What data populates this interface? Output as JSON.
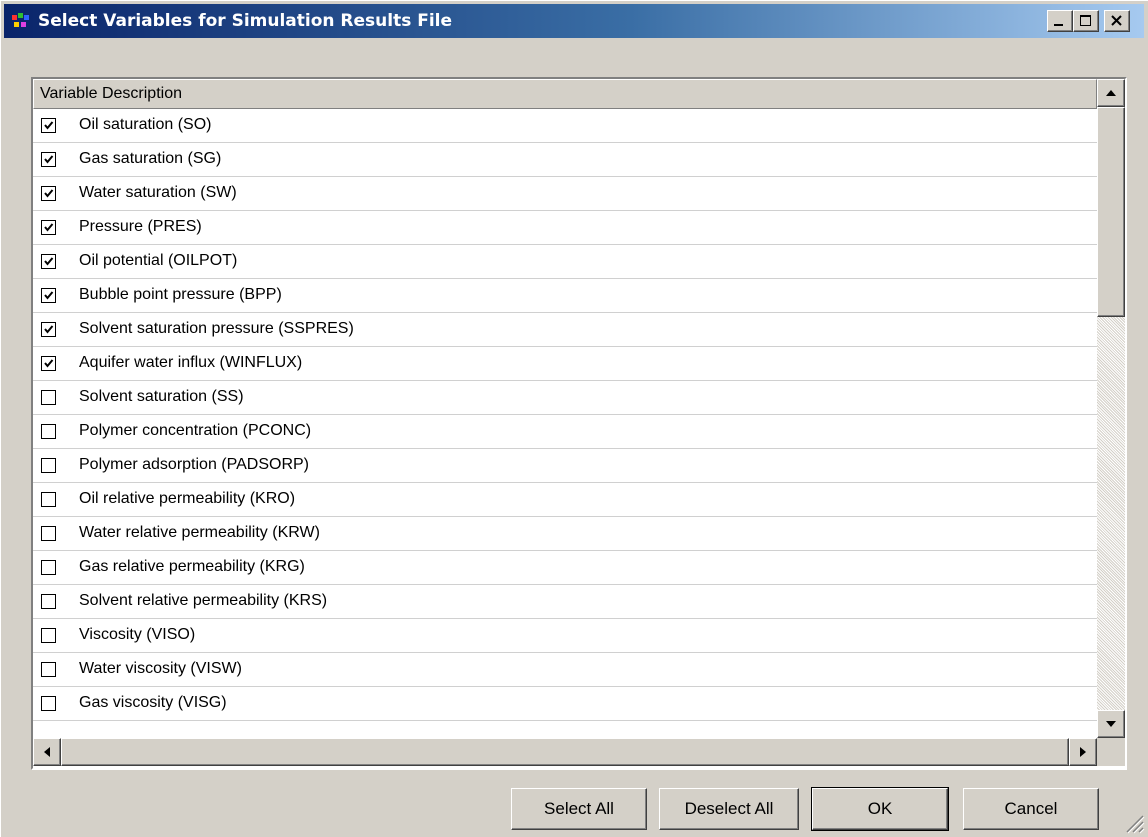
{
  "window": {
    "title": "Select Variables for Simulation Results File",
    "controls": {
      "minimize_icon": "minimize-icon",
      "maximize_icon": "maximize-icon",
      "close_icon": "close-icon"
    }
  },
  "list": {
    "column_header": "Variable Description",
    "rows": [
      {
        "label": "Oil saturation (SO)",
        "checked": true
      },
      {
        "label": "Gas saturation (SG)",
        "checked": true
      },
      {
        "label": "Water saturation (SW)",
        "checked": true
      },
      {
        "label": "Pressure (PRES)",
        "checked": true
      },
      {
        "label": "Oil potential (OILPOT)",
        "checked": true
      },
      {
        "label": "Bubble point pressure (BPP)",
        "checked": true
      },
      {
        "label": "Solvent saturation pressure (SSPRES)",
        "checked": true
      },
      {
        "label": "Aquifer water influx (WINFLUX)",
        "checked": true
      },
      {
        "label": "Solvent saturation (SS)",
        "checked": false
      },
      {
        "label": "Polymer concentration (PCONC)",
        "checked": false
      },
      {
        "label": "Polymer adsorption (PADSORP)",
        "checked": false
      },
      {
        "label": "Oil relative permeability (KRO)",
        "checked": false
      },
      {
        "label": "Water relative permeability (KRW)",
        "checked": false
      },
      {
        "label": "Gas relative permeability (KRG)",
        "checked": false
      },
      {
        "label": "Solvent relative permeability (KRS)",
        "checked": false
      },
      {
        "label": "Viscosity (VISO)",
        "checked": false
      },
      {
        "label": "Water viscosity (VISW)",
        "checked": false
      },
      {
        "label": "Gas viscosity (VISG)",
        "checked": false
      }
    ]
  },
  "buttons": {
    "select_all": "Select All",
    "deselect_all": "Deselect All",
    "ok": "OK",
    "cancel": "Cancel"
  },
  "colors": {
    "titlebar_start": "#0a246a",
    "titlebar_end": "#a6caf0",
    "face": "#d4d0c8"
  }
}
